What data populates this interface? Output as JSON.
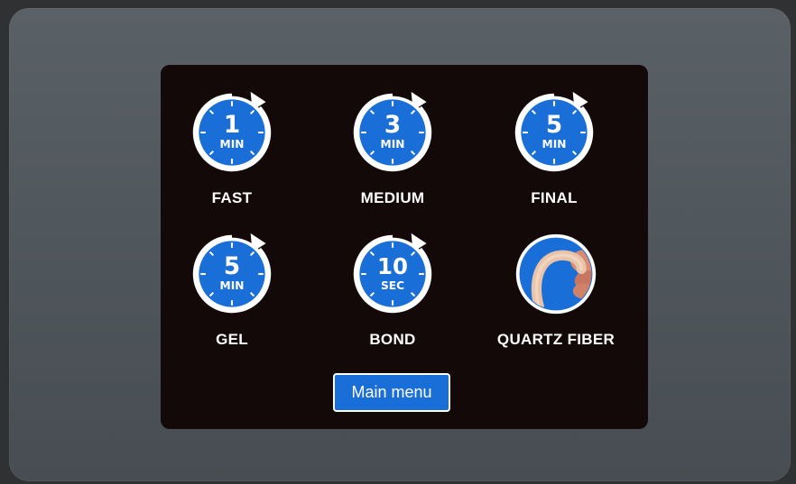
{
  "tiles": [
    {
      "name": "fast",
      "number": "1",
      "unit": "MIN",
      "label": "FAST"
    },
    {
      "name": "medium",
      "number": "3",
      "unit": "MIN",
      "label": "MEDIUM"
    },
    {
      "name": "final",
      "number": "5",
      "unit": "MIN",
      "label": "FINAL"
    },
    {
      "name": "gel",
      "number": "5",
      "unit": "MIN",
      "label": "GEL"
    },
    {
      "name": "bond",
      "number": "10",
      "unit": "SEC",
      "label": "BOND"
    },
    {
      "name": "quartz-fiber",
      "label": "QUARTZ FIBER",
      "icon": "quartz-fiber-photo-icon"
    }
  ],
  "main_menu_label": "Main menu",
  "colors": {
    "accent_blue": "#1a6ed8",
    "screen_bg": "#140909",
    "bezel": "#566065"
  },
  "icons": [
    "timer-icon",
    "quartz-fiber-photo-icon"
  ]
}
